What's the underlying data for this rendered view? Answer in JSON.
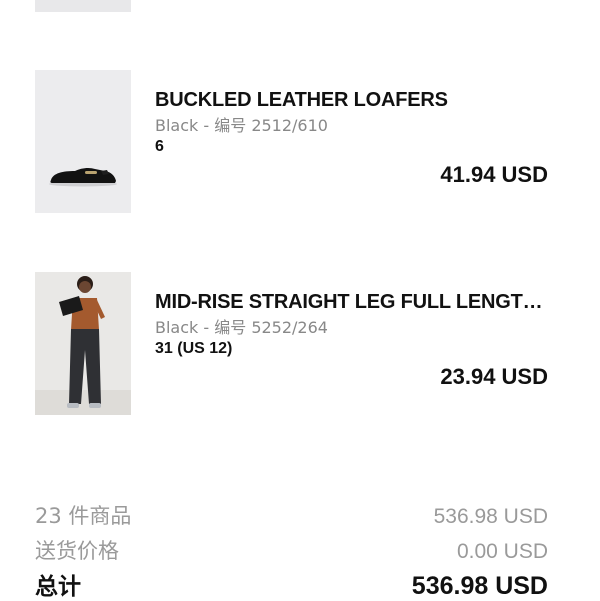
{
  "items": [
    {
      "title": "BUCKLED LEATHER LOAFERS",
      "meta": "Black - 编号 2512/610",
      "size": "6",
      "price": "41.94 USD",
      "image_icon": "loafer-shoe-image"
    },
    {
      "title": "MID-RISE STRAIGHT LEG FULL LENGTH J...",
      "meta": "Black - 编号 5252/264",
      "size": "31 (US 12)",
      "price": "23.94 USD",
      "image_icon": "jeans-model-image"
    }
  ],
  "summary": {
    "items_label": "23 件商品",
    "items_value": "536.98 USD",
    "shipping_label": "送货价格",
    "shipping_value": "0.00 USD",
    "total_label": "总计",
    "total_value": "536.98 USD"
  },
  "colors": {
    "text": "#111111",
    "muted": "#888888",
    "thumb_bg": "#ececee"
  }
}
